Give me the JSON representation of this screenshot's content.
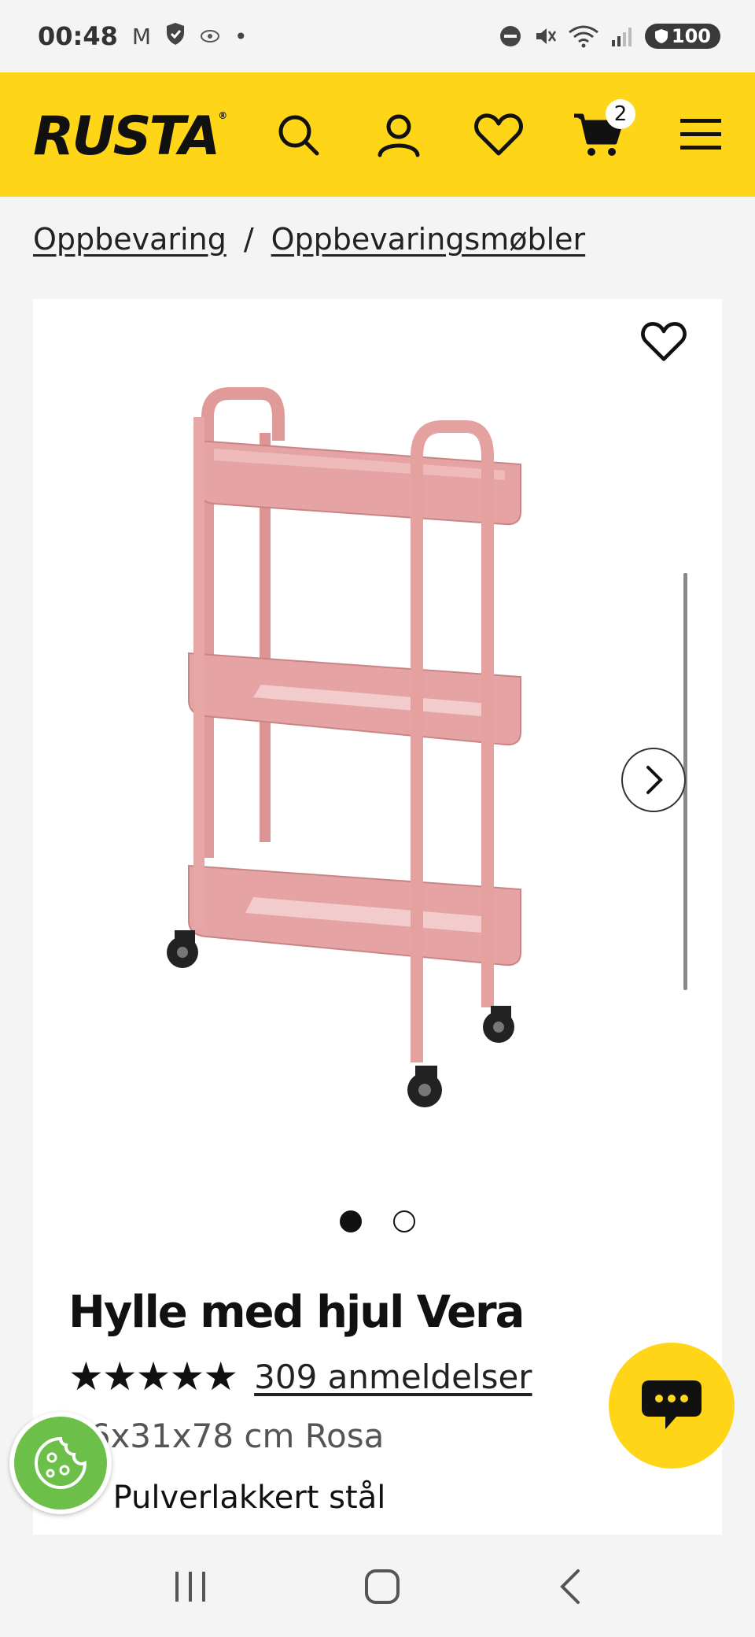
{
  "status": {
    "time": "00:48",
    "battery": "100"
  },
  "header": {
    "logo": "RUSTA",
    "cart_count": "2"
  },
  "breadcrumb": {
    "items": [
      "Oppbevaring",
      "Oppbevaringsmøbler"
    ],
    "separator": "/"
  },
  "product": {
    "title": "Hylle med hjul Vera",
    "stars": "★★★★★",
    "rating": 5,
    "reviews": "309 anmeldelser",
    "subtitle": "46x31x78 cm Rosa",
    "bullets": [
      "Pulverlakkert stål"
    ],
    "image_count": 2,
    "active_image": 1,
    "color": "#e6a3a3"
  },
  "theme": {
    "brand_yellow": "#ffd517",
    "cookie_green": "#6cc04a"
  }
}
